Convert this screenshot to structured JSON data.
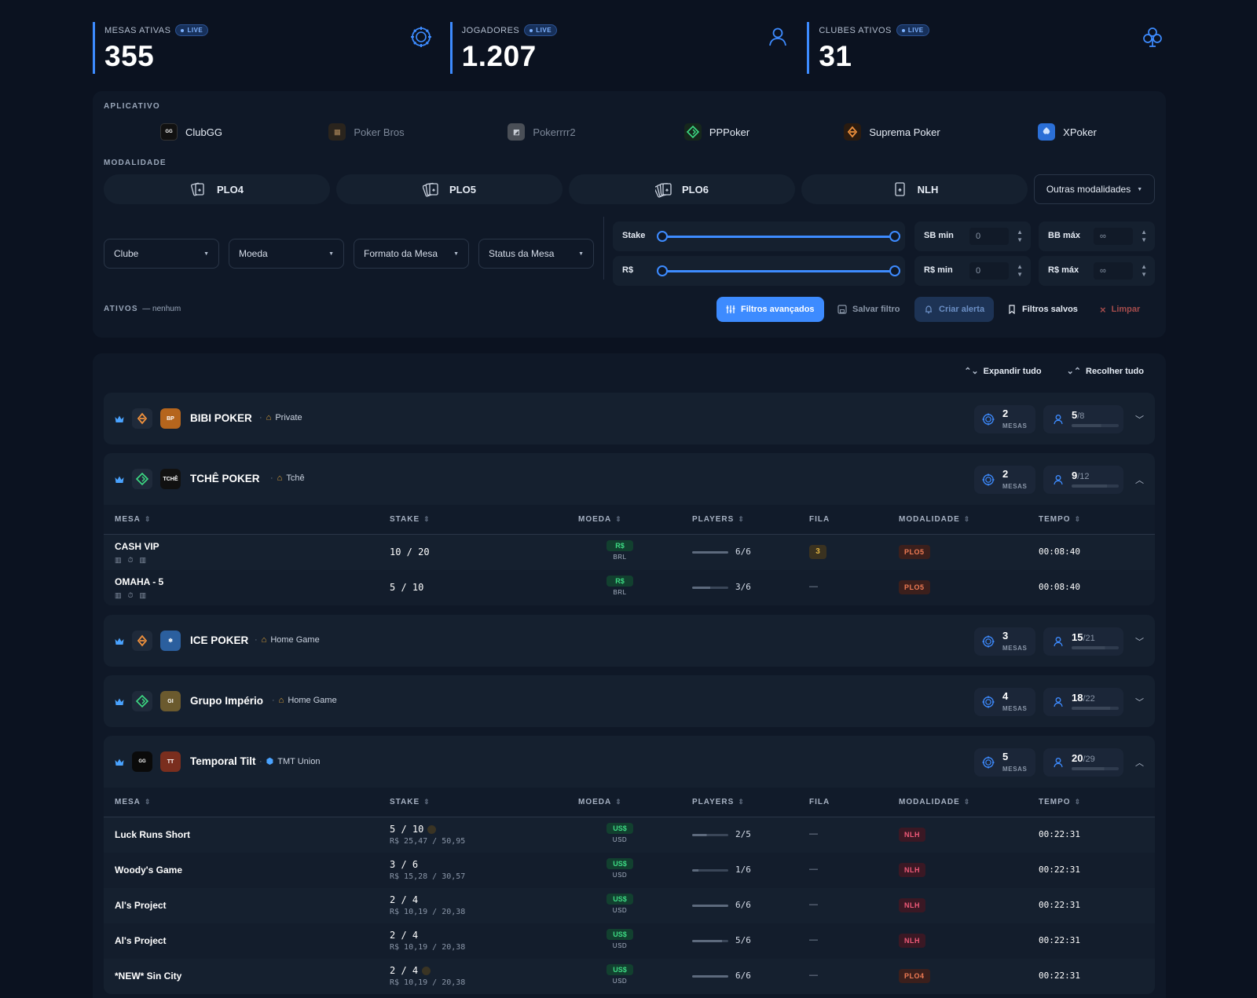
{
  "stats": [
    {
      "label": "MESAS ATIVAS",
      "badge": "LIVE",
      "value": "355",
      "icon": "poker-chip-icon"
    },
    {
      "label": "JOGADORES",
      "badge": "LIVE",
      "value": "1.207",
      "icon": "user-icon"
    },
    {
      "label": "CLUBES ATIVOS",
      "badge": "LIVE",
      "value": "31",
      "icon": "club-suit-icon"
    }
  ],
  "filters": {
    "app_title": "APLICATIVO",
    "apps": [
      "ClubGG",
      "Poker Bros",
      "Pokerrrr2",
      "PPPoker",
      "Suprema Poker",
      "XPoker"
    ],
    "mod_title": "MODALIDADE",
    "modalities": [
      "PLO4",
      "PLO5",
      "PLO6",
      "NLH"
    ],
    "other_modalities": "Outras modalidades",
    "dropdowns": [
      "Clube",
      "Moeda",
      "Formato da Mesa",
      "Status da Mesa"
    ],
    "stake_label": "Stake",
    "brl_label": "R$",
    "sb_min_label": "SB min",
    "sb_min_value": "0",
    "bb_max_label": "BB máx",
    "bb_max_value": "∞",
    "rs_min_label": "R$ min",
    "rs_min_value": "0",
    "rs_max_label": "R$ máx",
    "rs_max_value": "∞",
    "ativos_label": "ATIVOS",
    "ativos_value": "— nenhum",
    "btn_advanced": "Filtros avançados",
    "btn_save": "Salvar filtro",
    "btn_alert": "Criar alerta",
    "btn_saved": "Filtros salvos",
    "btn_clear": "Limpar"
  },
  "controls": {
    "expand": "Expandir tudo",
    "collapse": "Recolher tudo"
  },
  "table_headers": [
    "MESA",
    "STAKE",
    "MOEDA",
    "PLAYERS",
    "FILA",
    "MODALIDADE",
    "TEMPO"
  ],
  "mesas_label": "MESAS",
  "clubs": [
    {
      "name": "BIBI POKER",
      "tag": "Private",
      "mesas": "2",
      "players": "5",
      "max": "/8",
      "fill": 0.625
    },
    {
      "name": "TCHÊ POKER",
      "tag": "Tchê",
      "mesas": "2",
      "players": "9",
      "max": "/12",
      "fill": 0.75,
      "rows": [
        {
          "mesa": "CASH VIP",
          "stake": "10 / 20",
          "moeda": "R$",
          "moeda_sub": "BRL",
          "players": "6/6",
          "fill": 1.0,
          "fila": "3",
          "mod": "PLO5",
          "tempo": "00:08:40"
        },
        {
          "mesa": "OMAHA - 5",
          "stake": "5 / 10",
          "moeda": "R$",
          "moeda_sub": "BRL",
          "players": "3/6",
          "fill": 0.5,
          "fila": "—",
          "mod": "PLO5",
          "tempo": "00:08:40"
        }
      ]
    },
    {
      "name": "ICE POKER",
      "tag": "Home Game",
      "mesas": "3",
      "players": "15",
      "max": "/21",
      "fill": 0.71
    },
    {
      "name": "Grupo Império",
      "tag": "Home Game",
      "mesas": "4",
      "players": "18",
      "max": "/22",
      "fill": 0.82
    },
    {
      "name": "Temporal Tilt",
      "tag": "TMT Union",
      "mesas": "5",
      "players": "20",
      "max": "/29",
      "fill": 0.69,
      "rows": [
        {
          "mesa": "Luck Runs Short",
          "stake": "5 / 10",
          "stake2": "R$ 25,47 / 50,95",
          "moeda": "US$",
          "moeda_sub": "USD",
          "players": "2/5",
          "fill": 0.4,
          "fila": "—",
          "mod": "NLH",
          "tempo": "00:22:31"
        },
        {
          "mesa": "Woody's Game",
          "stake": "3 / 6",
          "stake2": "R$ 15,28 / 30,57",
          "moeda": "US$",
          "moeda_sub": "USD",
          "players": "1/6",
          "fill": 0.17,
          "fila": "—",
          "mod": "NLH",
          "tempo": "00:22:31"
        },
        {
          "mesa": "Al's Project",
          "stake": "2 / 4",
          "stake2": "R$ 10,19 / 20,38",
          "moeda": "US$",
          "moeda_sub": "USD",
          "players": "6/6",
          "fill": 1.0,
          "fila": "—",
          "mod": "NLH",
          "tempo": "00:22:31"
        },
        {
          "mesa": "Al's Project",
          "stake": "2 / 4",
          "stake2": "R$ 10,19 / 20,38",
          "moeda": "US$",
          "moeda_sub": "USD",
          "players": "5/6",
          "fill": 0.83,
          "fila": "—",
          "mod": "NLH",
          "tempo": "00:22:31"
        },
        {
          "mesa": "*NEW* Sin City",
          "stake": "2 / 4",
          "stake2": "R$ 10,19 / 20,38",
          "moeda": "US$",
          "moeda_sub": "USD",
          "players": "6/6",
          "fill": 1.0,
          "fila": "—",
          "mod": "PLO4",
          "tempo": "00:22:31"
        }
      ]
    }
  ],
  "colors": {
    "accent": "#3d8bff",
    "background": "#0b1220",
    "panel": "#0f1827",
    "green": "#3ddc84",
    "orange": "#f07b54",
    "red": "#f05a79",
    "gold": "#e0b341"
  }
}
